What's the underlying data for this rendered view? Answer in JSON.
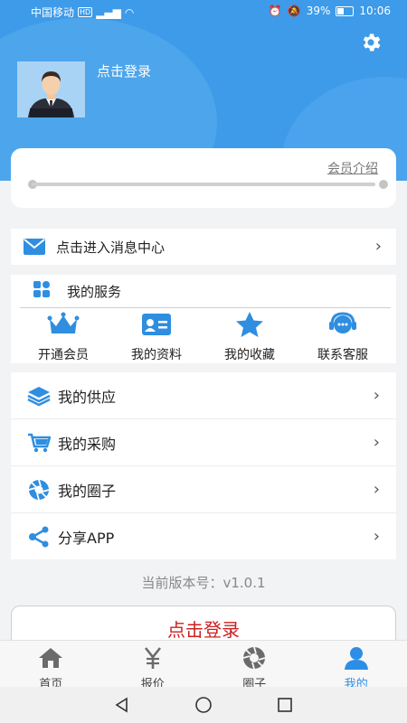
{
  "status_bar": {
    "carrier": "中国移动",
    "network": "HD",
    "battery": "39%",
    "time": "10:06"
  },
  "profile": {
    "login_prompt": "点击登录"
  },
  "member": {
    "intro_link": "会员介绍",
    "progress": 0
  },
  "message_center": {
    "label": "点击进入消息中心"
  },
  "services": {
    "title": "我的服务",
    "items": [
      {
        "label": "开通会员",
        "icon": "crown-icon"
      },
      {
        "label": "我的资料",
        "icon": "id-card-icon"
      },
      {
        "label": "我的收藏",
        "icon": "star-icon"
      },
      {
        "label": "联系客服",
        "icon": "headset-icon"
      }
    ]
  },
  "menu": [
    {
      "label": "我的供应",
      "icon": "layers-icon"
    },
    {
      "label": "我的采购",
      "icon": "cart-icon"
    },
    {
      "label": "我的圈子",
      "icon": "aperture-icon"
    },
    {
      "label": "分享APP",
      "icon": "share-icon"
    }
  ],
  "version_text": "当前版本号：v1.0.1",
  "login_button": "点击登录",
  "tabs": [
    {
      "label": "首页",
      "icon": "home-icon",
      "active": false
    },
    {
      "label": "报价",
      "icon": "yen-icon",
      "active": false
    },
    {
      "label": "圈子",
      "icon": "aperture-icon",
      "active": false
    },
    {
      "label": "我的",
      "icon": "user-icon",
      "active": true
    }
  ],
  "colors": {
    "primary": "#3d9be9",
    "accent_red": "#cc1f1f",
    "active_tab": "#2c8ee6"
  }
}
